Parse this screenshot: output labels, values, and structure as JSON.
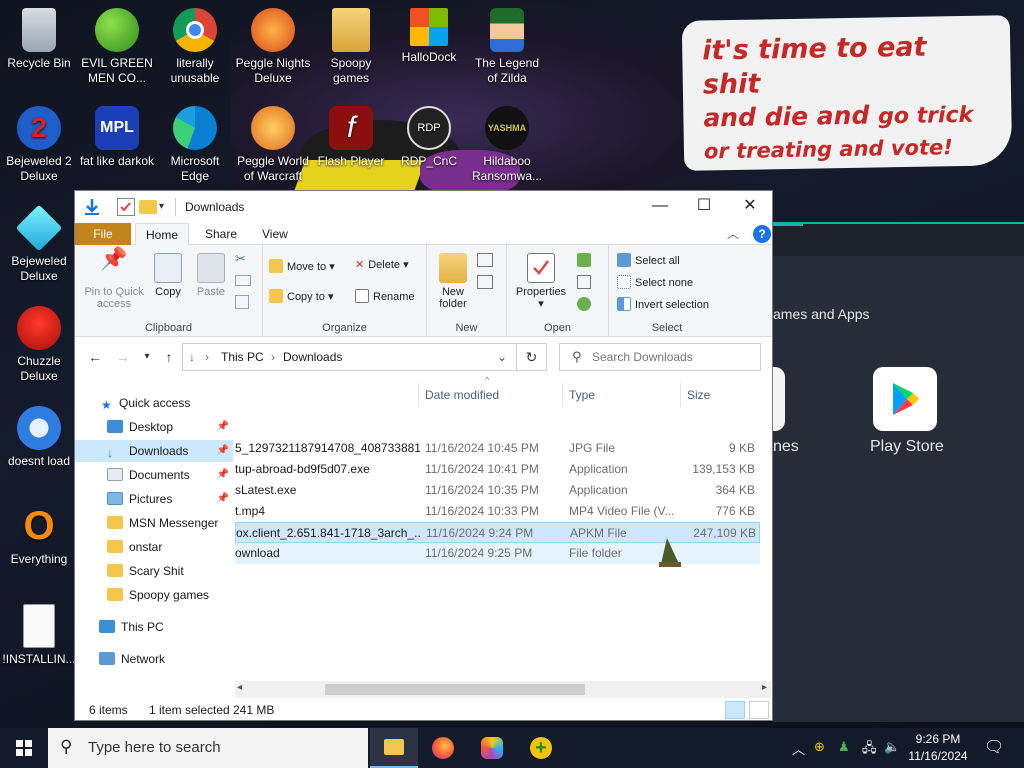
{
  "desktop": {
    "icons": [
      {
        "label": "Recycle Bin"
      },
      {
        "label": "EVIL GREEN MEN CO..."
      },
      {
        "label": "literally unusable"
      },
      {
        "label": "Peggle Nights Deluxe"
      },
      {
        "label": "Spoopy games"
      },
      {
        "label": "HalloDock"
      },
      {
        "label": "The Legend of Zilda"
      },
      {
        "label": "Bejeweled 2 Deluxe"
      },
      {
        "label": "fat like darkok"
      },
      {
        "label": "Microsoft Edge"
      },
      {
        "label": "Peggle World of Warcraft"
      },
      {
        "label": "Flash Player"
      },
      {
        "label": "RDP_CnC"
      },
      {
        "label": "Hildaboo Ransomwa..."
      },
      {
        "label": "Bejeweled Deluxe"
      },
      {
        "label": "Chuzzle Deluxe"
      },
      {
        "label": "doesnt load"
      },
      {
        "label": "Everything"
      },
      {
        "label": "!INSTALLIN..."
      }
    ],
    "wallpaper_text": {
      "line1": "it's time to eat shit",
      "line2a": "and die and",
      "line2b": "go trick",
      "line3": "or treating and vote!"
    },
    "icon_misc": {
      "hildaboo_text": "YASHMA",
      "rdp_symbol": "RDP",
      "flash_symbol": "f",
      "bejeweled2_symbol": "2",
      "everything_symbol": "O"
    }
  },
  "background_app": {
    "section_title": "ames and Apps",
    "tile_partial_label": "nes",
    "tile_label": "Play Store"
  },
  "explorer": {
    "title": "Downloads",
    "tabs": {
      "file": "File",
      "home": "Home",
      "share": "Share",
      "view": "View"
    },
    "ribbon": {
      "pin": "Pin to Quick access",
      "copy": "Copy",
      "paste": "Paste",
      "clipboard_group": "Clipboard",
      "move_to": "Move to",
      "copy_to": "Copy to",
      "delete": "Delete",
      "rename": "Rename",
      "organize_group": "Organize",
      "new_folder": "New folder",
      "new_group": "New",
      "properties": "Properties",
      "open_group": "Open",
      "select_all": "Select all",
      "select_none": "Select none",
      "invert_selection": "Invert selection",
      "select_group": "Select"
    },
    "address": {
      "segment1": "This PC",
      "segment2": "Downloads"
    },
    "search": {
      "placeholder": "Search Downloads"
    },
    "nav": {
      "quick_access": "Quick access",
      "items": [
        {
          "label": "Desktop",
          "pinned": true
        },
        {
          "label": "Downloads",
          "pinned": true
        },
        {
          "label": "Documents",
          "pinned": true
        },
        {
          "label": "Pictures",
          "pinned": true
        },
        {
          "label": "MSN Messenger",
          "pinned": false
        },
        {
          "label": "onstar",
          "pinned": false
        },
        {
          "label": "Scary Shit",
          "pinned": false
        },
        {
          "label": "Spoopy games",
          "pinned": false
        }
      ],
      "this_pc": "This PC",
      "network": "Network"
    },
    "columns": {
      "date": "Date modified",
      "type": "Type",
      "size": "Size"
    },
    "files": [
      {
        "name": "5_1297321187914708_408733881...",
        "date": "11/16/2024 10:45 PM",
        "type": "JPG File",
        "size": "9 KB"
      },
      {
        "name": "tup-abroad-bd9f5d07.exe",
        "date": "11/16/2024 10:41 PM",
        "type": "Application",
        "size": "139,153 KB"
      },
      {
        "name": "sLatest.exe",
        "date": "11/16/2024 10:35 PM",
        "type": "Application",
        "size": "364 KB"
      },
      {
        "name": "t.mp4",
        "date": "11/16/2024 10:33 PM",
        "type": "MP4 Video File (V...",
        "size": "776 KB"
      },
      {
        "name": "ox.client_2.651.841-1718_3arch_...",
        "date": "11/16/2024 9:24 PM",
        "type": "APKM File",
        "size": "247,109 KB"
      },
      {
        "name": "ownload",
        "date": "11/16/2024 9:25 PM",
        "type": "File folder",
        "size": ""
      }
    ],
    "status": {
      "items": "6 items",
      "selected": "1 item selected",
      "size": "241 MB"
    }
  },
  "taskbar": {
    "search_placeholder": "Type here to search",
    "time": "9:26 PM",
    "date": "11/16/2024"
  }
}
